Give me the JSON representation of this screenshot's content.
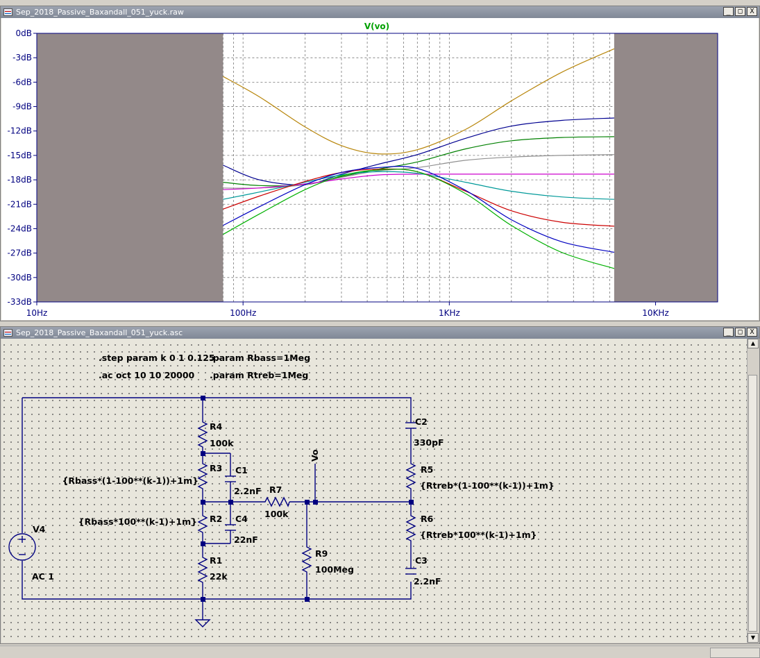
{
  "waveform_window": {
    "title": "Sep_2018_Passive_Baxandall_051_yuck.raw",
    "buttons": [
      "_",
      "□",
      "X"
    ]
  },
  "schematic_window": {
    "title": "Sep_2018_Passive_Baxandall_051_yuck.asc",
    "buttons": [
      "_",
      "□",
      "X"
    ]
  },
  "chart_data": {
    "type": "line",
    "title": "V(vo)",
    "x_scale": "log",
    "xlim": [
      10,
      20000
    ],
    "ylim": [
      -33,
      0
    ],
    "y_ticks": [
      "0dB",
      "-3dB",
      "-6dB",
      "-9dB",
      "-12dB",
      "-15dB",
      "-18dB",
      "-21dB",
      "-24dB",
      "-27dB",
      "-30dB",
      "-33dB"
    ],
    "x_ticks": [
      "10Hz",
      "100Hz",
      "1KHz",
      "10KHz"
    ],
    "x_tick_values": [
      10,
      100,
      1000,
      10000
    ],
    "data_range_hz": [
      80,
      6300
    ],
    "grid": true,
    "colors": {
      "plot_bg": "#ffffff",
      "masked_region": "#938989",
      "axis": "#000080",
      "title": "#00a000"
    },
    "series": [
      {
        "color": "#b8860b",
        "x": [
          80,
          120,
          200,
          300,
          450,
          700,
          1200,
          2000,
          3500,
          6300
        ],
        "values": [
          -5.3,
          -7.8,
          -11.5,
          -13.8,
          -14.8,
          -14.3,
          -11.8,
          -8.3,
          -4.8,
          -1.9
        ]
      },
      {
        "color": "#000090",
        "x": [
          80,
          120,
          200,
          300,
          450,
          700,
          1200,
          2000,
          3500,
          6300
        ],
        "values": [
          -16.2,
          -18.0,
          -18.6,
          -17.3,
          -16.1,
          -14.9,
          -12.9,
          -11.4,
          -10.7,
          -10.4
        ]
      },
      {
        "color": "#008000",
        "x": [
          80,
          120,
          200,
          300,
          450,
          700,
          1200,
          2000,
          3500,
          6300
        ],
        "values": [
          -18.3,
          -18.7,
          -18.6,
          -17.6,
          -16.7,
          -15.8,
          -14.2,
          -13.2,
          -12.8,
          -12.7
        ]
      },
      {
        "color": "#909090",
        "x": [
          80,
          120,
          200,
          300,
          450,
          700,
          1200,
          2000,
          3500,
          6300
        ],
        "values": [
          -19.0,
          -19.0,
          -18.6,
          -17.7,
          -16.9,
          -16.5,
          -15.6,
          -15.2,
          -15.0,
          -14.9
        ]
      },
      {
        "color": "#cc00cc",
        "x": [
          80,
          120,
          200,
          300,
          450,
          700,
          1200,
          2000,
          3500,
          6300
        ],
        "values": [
          -19.2,
          -19.0,
          -18.5,
          -17.9,
          -17.4,
          -17.3,
          -17.3,
          -17.3,
          -17.3,
          -17.3
        ]
      },
      {
        "color": "#009999",
        "x": [
          80,
          120,
          200,
          300,
          450,
          700,
          1200,
          2000,
          3500,
          6300
        ],
        "values": [
          -20.4,
          -19.5,
          -18.3,
          -17.4,
          -17.0,
          -17.2,
          -18.3,
          -19.4,
          -20.1,
          -20.4
        ]
      },
      {
        "color": "#cc0000",
        "x": [
          80,
          120,
          200,
          300,
          450,
          700,
          1200,
          2000,
          3500,
          6300
        ],
        "values": [
          -21.6,
          -20.0,
          -18.2,
          -17.1,
          -16.7,
          -17.0,
          -19.4,
          -21.8,
          -23.2,
          -23.7
        ]
      },
      {
        "color": "#0000c0",
        "x": [
          80,
          120,
          200,
          300,
          450,
          700,
          1200,
          2000,
          3500,
          6300
        ],
        "values": [
          -23.6,
          -21.3,
          -18.6,
          -17.1,
          -16.5,
          -16.6,
          -19.3,
          -22.9,
          -25.6,
          -26.9
        ]
      },
      {
        "color": "#00b000",
        "x": [
          80,
          120,
          200,
          300,
          450,
          700,
          1200,
          2000,
          3500,
          6300
        ],
        "values": [
          -24.7,
          -22.2,
          -19.2,
          -17.5,
          -16.8,
          -17.0,
          -19.7,
          -23.6,
          -26.9,
          -28.9
        ]
      }
    ]
  },
  "schematic": {
    "directives": [
      ".step param k 0 1 0.125",
      ".param Rbass=1Meg",
      ".ac oct 10 10 20000",
      ".param Rtreb=1Meg"
    ],
    "components": {
      "R4": {
        "name": "R4",
        "value": "100k"
      },
      "R3": {
        "name": "R3",
        "value": "{Rbass*(1-100**(k-1))+1m}"
      },
      "R2": {
        "name": "R2",
        "value": "{Rbass*100**(k-1)+1m}"
      },
      "R1": {
        "name": "R1",
        "value": "22k"
      },
      "C1": {
        "name": "C1",
        "value": "2.2nF"
      },
      "C4": {
        "name": "C4",
        "value": "22nF"
      },
      "R7": {
        "name": "R7",
        "value": "100k"
      },
      "R9": {
        "name": "R9",
        "value": "100Meg"
      },
      "C2": {
        "name": "C2",
        "value": "330pF"
      },
      "R5": {
        "name": "R5",
        "value": "{Rtreb*(1-100**(k-1))+1m}"
      },
      "R6": {
        "name": "R6",
        "value": "{Rtreb*100**(k-1)+1m}"
      },
      "C3": {
        "name": "C3",
        "value": "2.2nF"
      },
      "V4": {
        "name": "V4",
        "value": "AC 1"
      }
    },
    "net_label": "Vo",
    "colors": {
      "wire": "#000080",
      "text": "#000000",
      "background": "#e8e6dc"
    }
  }
}
